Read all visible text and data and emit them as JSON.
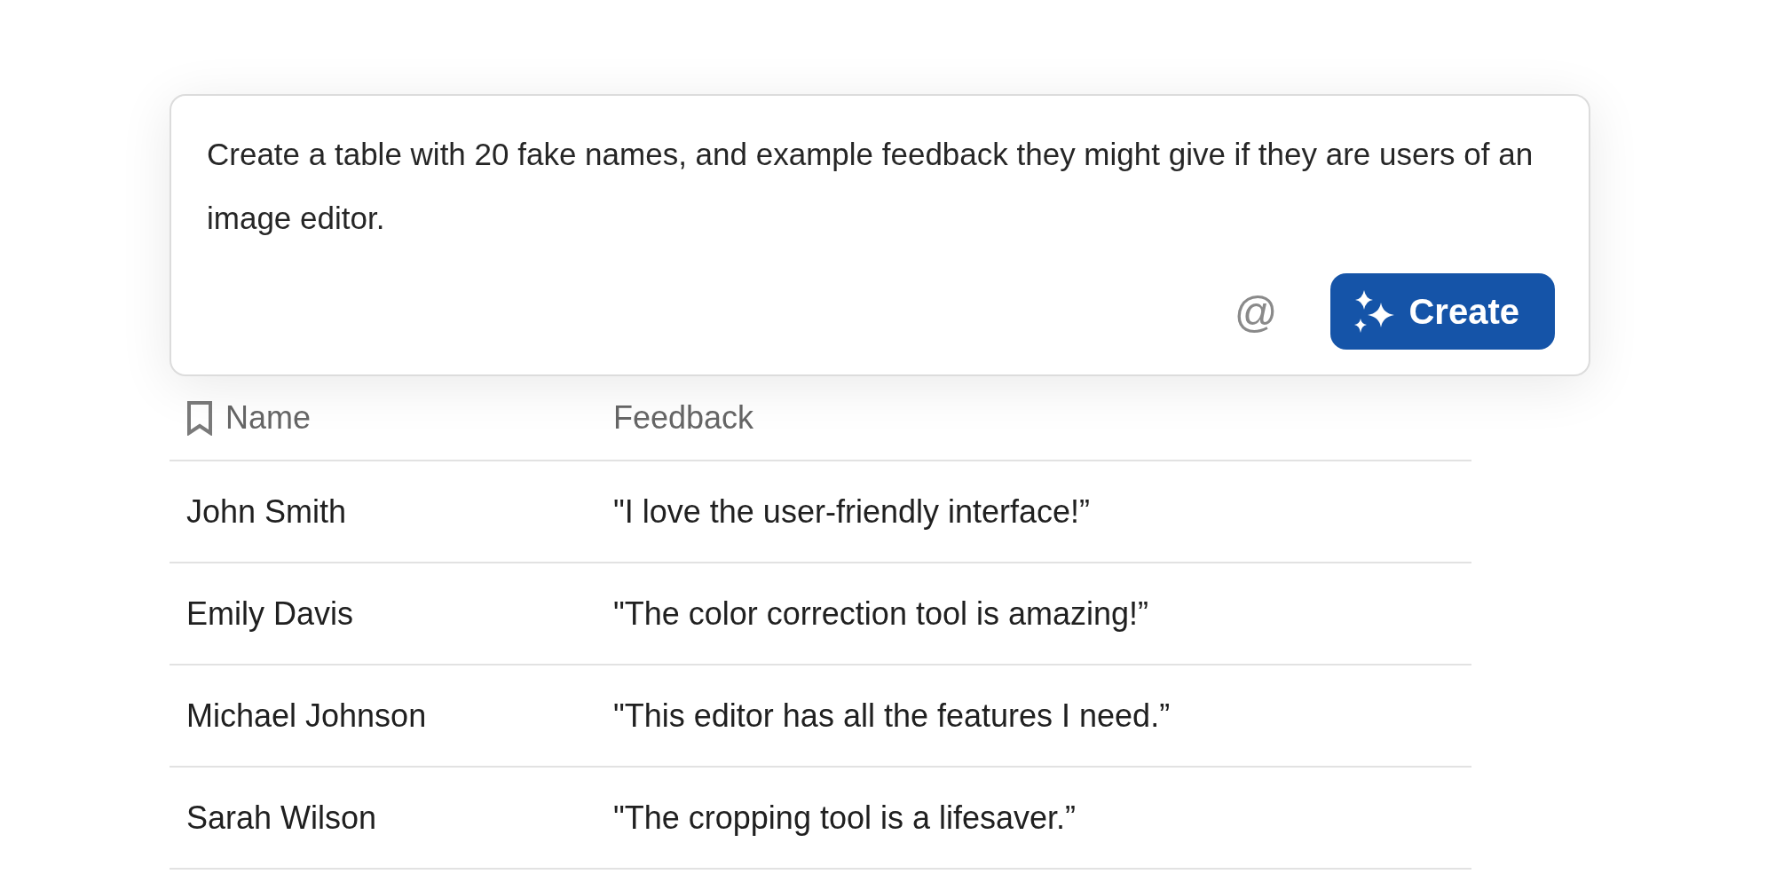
{
  "prompt": {
    "value": "Create a table with 20 fake names, and example feedback they might give if they are users of an image editor.",
    "mention": "@",
    "submit": "Create"
  },
  "table": {
    "columns": [
      "Name",
      "Feedback"
    ],
    "rows": [
      [
        "John Smith",
        "\"I love the user-friendly interface!”"
      ],
      [
        "Emily Davis",
        "\"The color correction tool is amazing!”"
      ],
      [
        "Michael Johnson",
        "\"This editor has all the features I need.”"
      ],
      [
        "Sarah Wilson",
        "\"The cropping tool is a lifesaver.”"
      ]
    ]
  }
}
